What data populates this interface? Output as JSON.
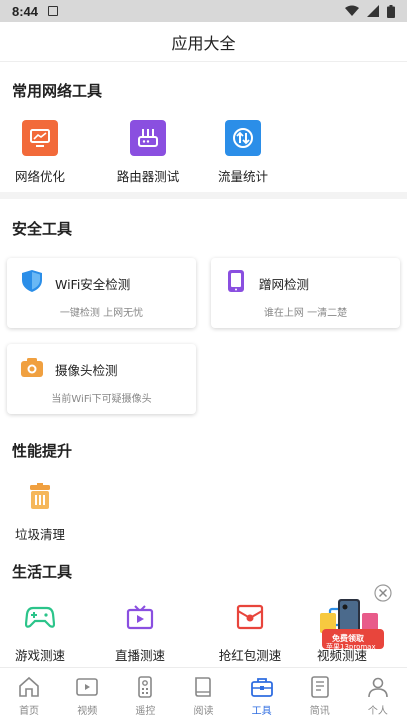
{
  "status_bar": {
    "time": "8:44"
  },
  "header": {
    "title": "应用大全"
  },
  "sections": {
    "network": {
      "title": "常用网络工具",
      "items": [
        {
          "label": "网络优化",
          "icon": "monitor-chart-icon",
          "color": "#f26a3a"
        },
        {
          "label": "路由器测试",
          "icon": "router-icon",
          "color": "#8a4fe0"
        },
        {
          "label": "流量统计",
          "icon": "traffic-arrows-icon",
          "color": "#2b8ee8"
        }
      ]
    },
    "security": {
      "title": "安全工具",
      "cards": [
        {
          "title": "WiFi安全检测",
          "subtitle": "一键检测 上网无忧",
          "icon": "shield-icon"
        },
        {
          "title": "蹭网检测",
          "subtitle": "谁在上网 一清二楚",
          "icon": "phone-icon"
        },
        {
          "title": "摄像头检测",
          "subtitle": "当前WiFi下可疑摄像头",
          "icon": "camera-icon"
        }
      ]
    },
    "performance": {
      "title": "性能提升",
      "items": [
        {
          "label": "垃圾清理",
          "icon": "trash-icon",
          "color": "#f0a040"
        }
      ]
    },
    "life": {
      "title": "生活工具",
      "items": [
        {
          "label": "游戏测速",
          "icon": "gamepad-icon",
          "color": "#2bc48a"
        },
        {
          "label": "直播测速",
          "icon": "tv-icon",
          "color": "#8a4fe0"
        },
        {
          "label": "抢红包测速",
          "icon": "red-envelope-icon",
          "color": "#e8453c"
        },
        {
          "label": "视频测速",
          "icon": "video-icon",
          "color": "#2b8ee8"
        }
      ]
    }
  },
  "ad": {
    "text1": "免费领取",
    "text2": "苹果13promax"
  },
  "tabbar": {
    "items": [
      {
        "label": "首页",
        "icon": "home-icon"
      },
      {
        "label": "视频",
        "icon": "video-play-icon"
      },
      {
        "label": "遥控",
        "icon": "remote-icon"
      },
      {
        "label": "阅读",
        "icon": "book-icon"
      },
      {
        "label": "工具",
        "icon": "toolbox-icon",
        "active": true
      },
      {
        "label": "简讯",
        "icon": "news-icon"
      },
      {
        "label": "个人",
        "icon": "person-icon"
      }
    ]
  },
  "colors": {
    "accent": "#2f6de1"
  }
}
